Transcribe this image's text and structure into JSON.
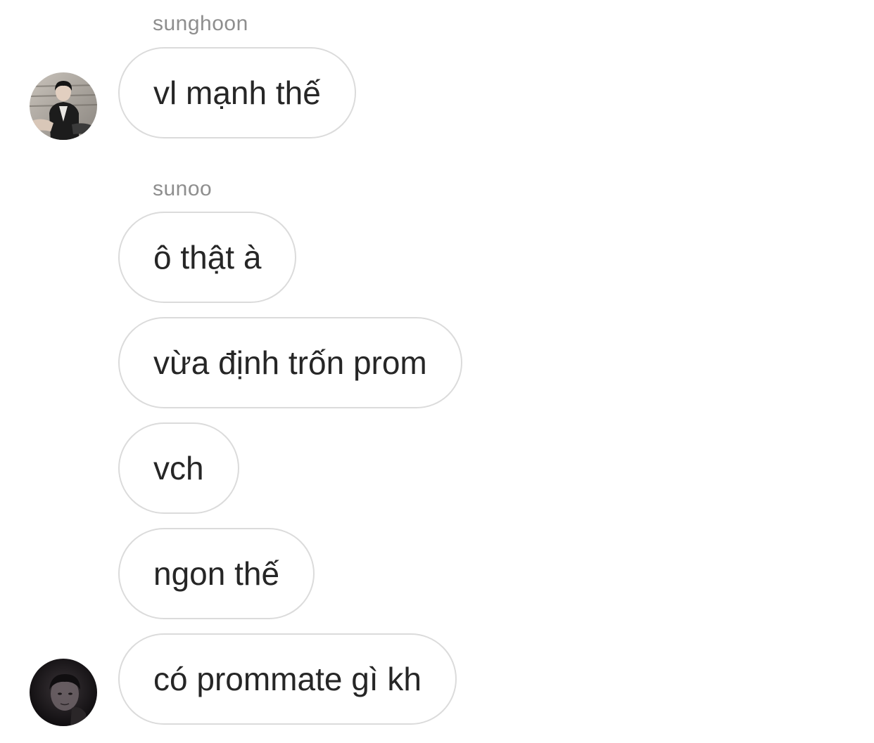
{
  "groups": [
    {
      "sender": "sunghoon",
      "avatar_icon": "sunghoon-profile-photo",
      "messages": [
        "vl mạnh thế"
      ]
    },
    {
      "sender": "sunoo",
      "avatar_icon": "sunoo-profile-photo",
      "messages": [
        "ô thật à",
        "vừa định trốn prom",
        "vch",
        "ngon thế",
        "có prommate gì kh"
      ]
    }
  ],
  "colors": {
    "background": "#ffffff",
    "bubble_border": "#dbdbdb",
    "message_text": "#262626",
    "sender_name": "#8e8e8e"
  }
}
